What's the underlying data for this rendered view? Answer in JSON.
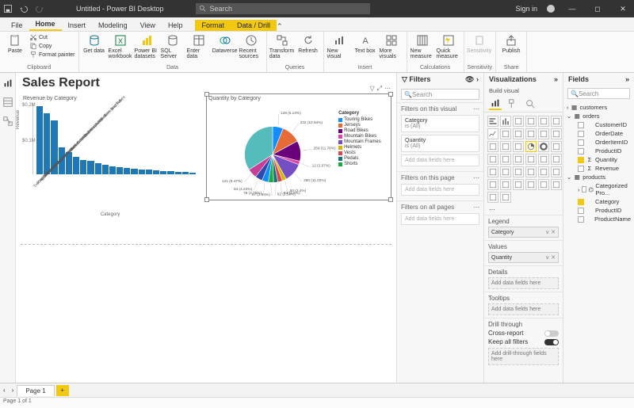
{
  "titlebar": {
    "title": "Untitled - Power BI Desktop",
    "search_placeholder": "Search",
    "signin": "Sign in"
  },
  "ribbon_tabs": [
    "File",
    "Home",
    "Insert",
    "Modeling",
    "View",
    "Help",
    "Format",
    "Data / Drill"
  ],
  "ribbon_tabs_active": 1,
  "ribbon": {
    "clipboard": {
      "label": "Clipboard",
      "paste": "Paste",
      "cut": "Cut",
      "copy": "Copy",
      "format_painter": "Format painter"
    },
    "data": {
      "label": "Data",
      "get_data": "Get data",
      "excel": "Excel workbook",
      "pbi": "Power BI datasets",
      "sql": "SQL Server",
      "enter": "Enter data",
      "dataverse": "Dataverse",
      "recent": "Recent sources"
    },
    "queries": {
      "label": "Queries",
      "transform": "Transform data",
      "refresh": "Refresh"
    },
    "insert": {
      "label": "Insert",
      "new_visual": "New visual",
      "text_box": "Text box",
      "more": "More visuals"
    },
    "calc": {
      "label": "Calculations",
      "new_measure": "New measure",
      "quick_measure": "Quick measure"
    },
    "sens": {
      "label": "Sensitivity",
      "sensitivity": "Sensitivity"
    },
    "share": {
      "label": "Share",
      "publish": "Publish"
    }
  },
  "report_title": "Sales Report",
  "bar_chart": {
    "title": "Revenue by Category",
    "yvals": [
      "$0.2M",
      "$0.1M"
    ],
    "xlabel": "Category",
    "ylabel": "Revenue"
  },
  "pie_chart": {
    "title": "Quantity by Category",
    "legend_header": "Category"
  },
  "chart_data": [
    {
      "type": "bar",
      "title": "Revenue by Category",
      "xlabel": "Category",
      "ylabel": "Revenue",
      "ylim": [
        0,
        250000
      ],
      "categories": [
        "Touring Bikes",
        "Road Bikes",
        "Mountain Bikes",
        "Mountain Frames",
        "Touring Frames",
        "Wheels",
        "Forks",
        "Road Frames",
        "Cranksets",
        "Headsets",
        "Brakes",
        "Pedals",
        "Handlebars",
        "Derailleurs",
        "Vests",
        "Saddles",
        "Jerseys",
        "Helmets",
        "Shorts",
        "Chains",
        "Bottom Brackets",
        "Tires and Tubes"
      ],
      "values": [
        240000,
        215000,
        190000,
        95000,
        78000,
        62000,
        50000,
        46000,
        38000,
        32000,
        28000,
        25000,
        22000,
        20000,
        18000,
        16000,
        14000,
        12000,
        10000,
        8000,
        7000,
        5000
      ]
    },
    {
      "type": "pie",
      "title": "Quantity by Category",
      "legend": [
        "Touring Bikes",
        "Jerseys",
        "Road Bikes",
        "Mountain Bikes",
        "Mountain Frames",
        "Helmets",
        "Vests",
        "Pedals",
        "Shorts"
      ],
      "slices": [
        {
          "label": "128 (6.13%)",
          "value": 128,
          "pct": 6.13,
          "color": "#118DFF"
        },
        {
          "label": "232 (10.94%)",
          "value": 232,
          "pct": 10.94,
          "color": "#E66C37"
        },
        {
          "label": "259 (11.78%)",
          "value": 259,
          "pct": 11.78,
          "color": "#6B007B"
        },
        {
          "label": "12 (2.07%)",
          "value": 12,
          "pct": 2.07,
          "color": "#E044A7"
        },
        {
          "label": "280 (11.02%)",
          "value": 280,
          "pct": 11.02,
          "color": "#744EC2"
        },
        {
          "label": "50 (2.4%)",
          "value": 50,
          "pct": 2.4,
          "color": "#D9B300"
        },
        {
          "label": "53 (2.6%)",
          "value": 53,
          "pct": 2.6,
          "color": "#D64550"
        },
        {
          "label": "62 (2.56%)",
          "value": 62,
          "pct": 2.56,
          "color": "#197278"
        },
        {
          "label": "67 (2.94%)",
          "value": 67,
          "pct": 2.94,
          "color": "#1AAB40"
        },
        {
          "label": "79 (3.75%)",
          "value": 79,
          "pct": 3.75,
          "color": "#118DFF"
        },
        {
          "label": "84 (4.23%)",
          "value": 84,
          "pct": 4.23,
          "color": "#3049AD"
        },
        {
          "label": "121 (5.47%)",
          "value": 121,
          "pct": 5.47,
          "color": "#C83D95"
        }
      ]
    }
  ],
  "filters_panel": {
    "header": "Filters",
    "search": "Search",
    "on_visual": "Filters on this visual",
    "on_page": "Filters on this page",
    "on_all": "Filters on all pages",
    "add": "Add data fields here",
    "card1": {
      "name": "Category",
      "val": "is (All)"
    },
    "card2": {
      "name": "Quantity",
      "val": "is (All)"
    }
  },
  "vis_panel": {
    "header": "Visualizations",
    "build": "Build visual",
    "legend": "Legend",
    "legend_val": "Category",
    "values": "Values",
    "values_val": "Quantity",
    "details": "Details",
    "tooltips": "Tooltips",
    "drill": "Drill through",
    "cross": "Cross-report",
    "keep": "Keep all filters",
    "add": "Add data fields here",
    "add_drill": "Add drill-through fields here",
    "pie_tooltip": "Pie chart",
    "viz_names": [
      "stacked-bar",
      "stacked-column",
      "clustered-bar",
      "clustered-column",
      "100-stacked-bar",
      "100-stacked-column",
      "line",
      "area",
      "stacked-area",
      "line-stacked-column",
      "line-clustered-column",
      "ribbon",
      "waterfall",
      "funnel",
      "scatter",
      "pie",
      "donut",
      "treemap",
      "map",
      "filled-map",
      "azure-map",
      "gauge",
      "card",
      "multi-row-card",
      "kpi",
      "slicer",
      "table",
      "matrix",
      "r-visual",
      "py-visual",
      "key-influencers",
      "decomposition-tree",
      "qa",
      "smart-narrative",
      "paginated-report",
      "power-apps",
      "power-automate",
      "get-more"
    ]
  },
  "fields_panel": {
    "header": "Fields",
    "search": "Search",
    "tables": {
      "customers": {
        "name": "customers"
      },
      "orders": {
        "name": "orders",
        "fields": [
          "CustomerID",
          "OrderDate",
          "OrderItemID",
          "ProductID",
          "Quantity",
          "Revenue"
        ],
        "checked": [
          "Quantity"
        ]
      },
      "products": {
        "name": "products",
        "fields": [
          "Categorized Pro...",
          "Category",
          "ProductID",
          "ProductName"
        ],
        "checked": [
          "Category"
        ]
      }
    }
  },
  "pages": {
    "p1": "Page 1"
  },
  "status": "Page 1 of 1"
}
